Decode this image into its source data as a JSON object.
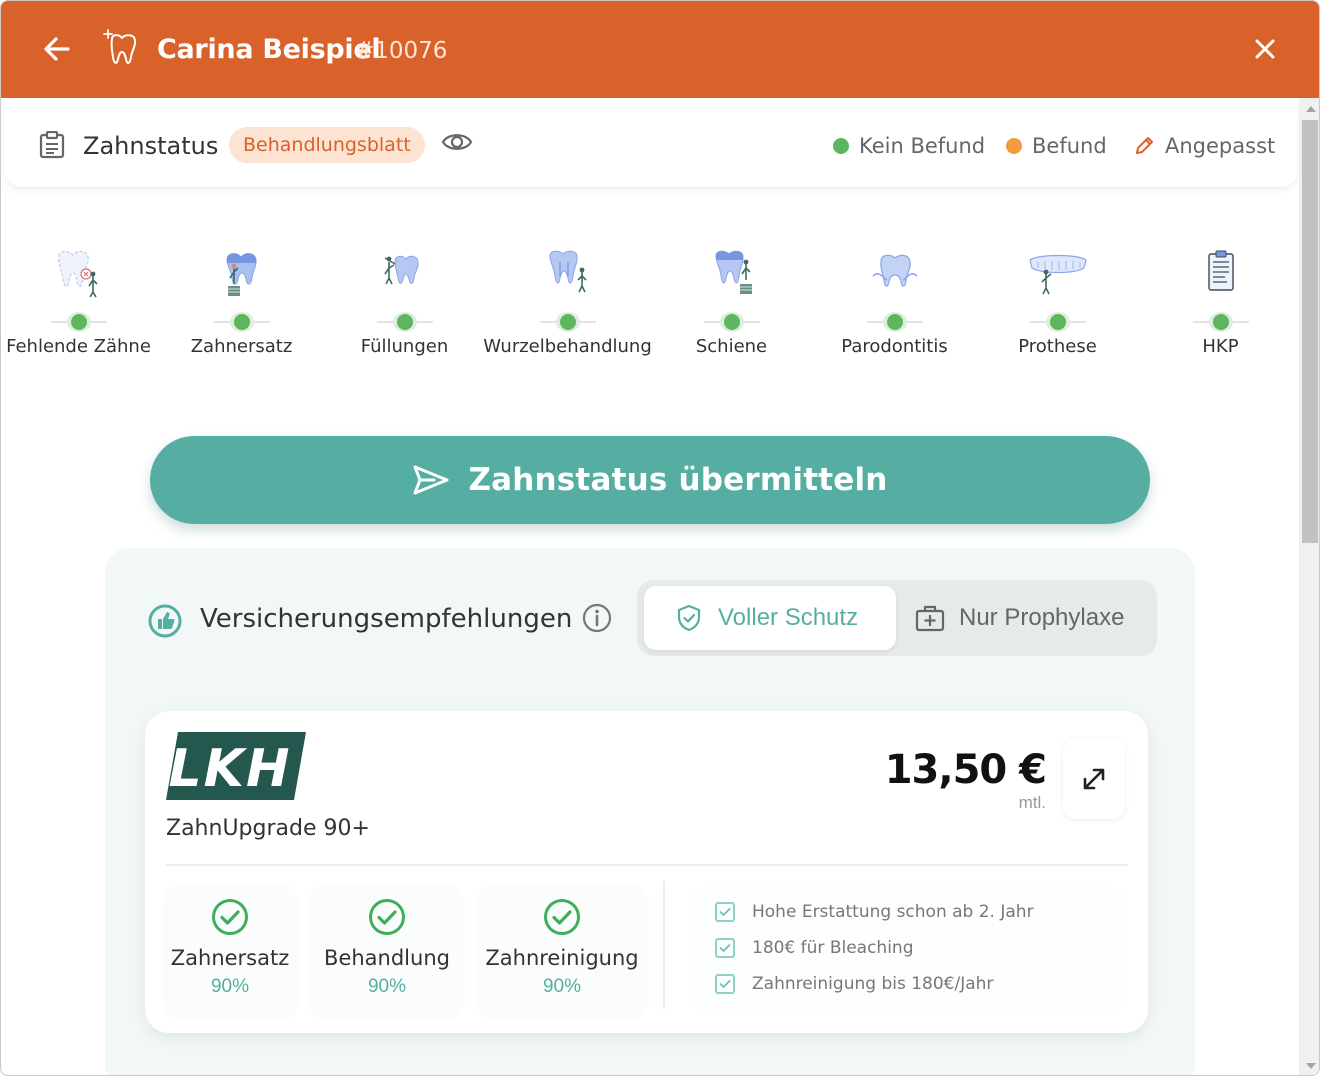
{
  "header": {
    "patient_name": "Carina Beispiel",
    "patient_id": "#10076",
    "accent_color": "#d9622b"
  },
  "status_bar": {
    "title": "Zahnstatus",
    "badge": "Behandlungsblatt",
    "legend": [
      {
        "label": "Kein Befund",
        "color": "#5db65f"
      },
      {
        "label": "Befund",
        "color": "#f39c3b"
      },
      {
        "label": "Angepasst",
        "icon": "pencil-icon",
        "color": "#d9622b"
      }
    ]
  },
  "categories": [
    {
      "label": "Fehlende Zähne",
      "icon": "missing-tooth-icon",
      "status": "Kein Befund"
    },
    {
      "label": "Zahnersatz",
      "icon": "dental-crown-icon",
      "status": "Kein Befund"
    },
    {
      "label": "Füllungen",
      "icon": "filling-icon",
      "status": "Kein Befund"
    },
    {
      "label": "Wurzelbehandlung",
      "icon": "root-canal-icon",
      "status": "Kein Befund"
    },
    {
      "label": "Schiene",
      "icon": "splint-icon",
      "status": "Kein Befund"
    },
    {
      "label": "Parodontitis",
      "icon": "gum-icon",
      "status": "Kein Befund"
    },
    {
      "label": "Prothese",
      "icon": "denture-icon",
      "status": "Kein Befund"
    },
    {
      "label": "HKP",
      "icon": "clipboard-icon",
      "status": "Kein Befund"
    }
  ],
  "submit_button": {
    "label": "Zahnstatus übermitteln",
    "color": "#56aea3"
  },
  "insurance": {
    "title": "Versicherungsempfehlungen",
    "toggle": {
      "active": "Voller Schutz",
      "inactive": "Nur Prophylaxe"
    },
    "plan": {
      "provider_logo_text": "LKH",
      "name": "ZahnUpgrade 90+",
      "price": "13,50 €",
      "price_unit": "mtl.",
      "coverage": [
        {
          "name": "Zahnersatz",
          "percent": "90%"
        },
        {
          "name": "Behandlung",
          "percent": "90%"
        },
        {
          "name": "Zahnreinigung",
          "percent": "90%"
        }
      ],
      "features": [
        "Hohe Erstattung schon ab 2. Jahr",
        "180€ für Bleaching",
        "Zahnreinigung bis 180€/Jahr"
      ]
    }
  }
}
